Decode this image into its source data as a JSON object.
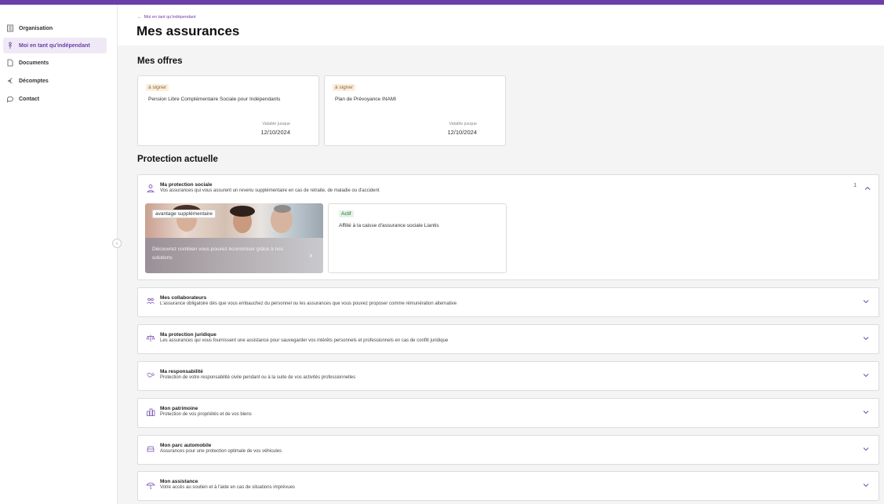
{
  "colors": {
    "accent": "#6c3fa8",
    "sign_badge_bg": "#fbeedc",
    "active_badge_bg": "#e5f3e6"
  },
  "sidebar": {
    "items": [
      {
        "label": "Organisation",
        "icon": "building-icon",
        "active": false
      },
      {
        "label": "Moi en tant qu'indépendant",
        "icon": "person-icon",
        "active": true
      },
      {
        "label": "Documents",
        "icon": "document-icon",
        "active": false
      },
      {
        "label": "Décomptes",
        "icon": "euro-icon",
        "active": false
      },
      {
        "label": "Contact",
        "icon": "chat-icon",
        "active": false
      }
    ]
  },
  "header": {
    "back_label": "Moi en tant qu'indépendant",
    "title": "Mes assurances"
  },
  "offers": {
    "title": "Mes offres",
    "items": [
      {
        "badge": "à signer",
        "name": "Pension Libre Complémentaire Sociale pour Indépendants",
        "valid_label": "Valable jusque",
        "valid_date": "12/10/2024"
      },
      {
        "badge": "à signer",
        "name": "Plan de Prévoyance INAMI",
        "valid_label": "Valable jusque",
        "valid_date": "12/10/2024"
      }
    ]
  },
  "protection": {
    "title": "Protection actuelle",
    "expanded": {
      "title": "Ma protection sociale",
      "description": "Vos assurances qui vous assurent un revenu supplémentaire en cas de retraite, de maladie ou d'accident",
      "count": "1",
      "icon": "person-outline-icon",
      "promo": {
        "badge": "avantage supplémentaire",
        "text": "Découvrez combien vous pouvez économiser grâce à nos solutions"
      },
      "status": {
        "badge": "Actif",
        "text": "Affilié à la caisse d'assurance sociale Liantis"
      }
    },
    "panels": [
      {
        "title": "Mes collaborateurs",
        "description": "L'assurance obligatoire dès que vous embauchez du personnel ou les assurances que vous pouvez proposer comme rémunération alternative",
        "icon": "people-icon"
      },
      {
        "title": "Ma protection juridique",
        "description": "Les assurances qui vous fournissent une assistance pour sauvegarder vos intérêts personnels et professionnels en cas de conflit juridique",
        "icon": "legal-icon"
      },
      {
        "title": "Ma responsabilité",
        "description": "Protection de votre responsabilité civile pendant ou à la suite de vos activités professionnelles",
        "icon": "handshake-icon"
      },
      {
        "title": "Mon patrimoine",
        "description": "Protection de vos propriétés et de vos biens",
        "icon": "buildings-icon"
      },
      {
        "title": "Mon parc automobile",
        "description": "Assurances pour une protection optimale de vos véhicules",
        "icon": "car-icon"
      },
      {
        "title": "Mon assistance",
        "description": "Votre accès au soutien et à l'aide en cas de situations imprévues",
        "icon": "umbrella-icon"
      }
    ]
  }
}
